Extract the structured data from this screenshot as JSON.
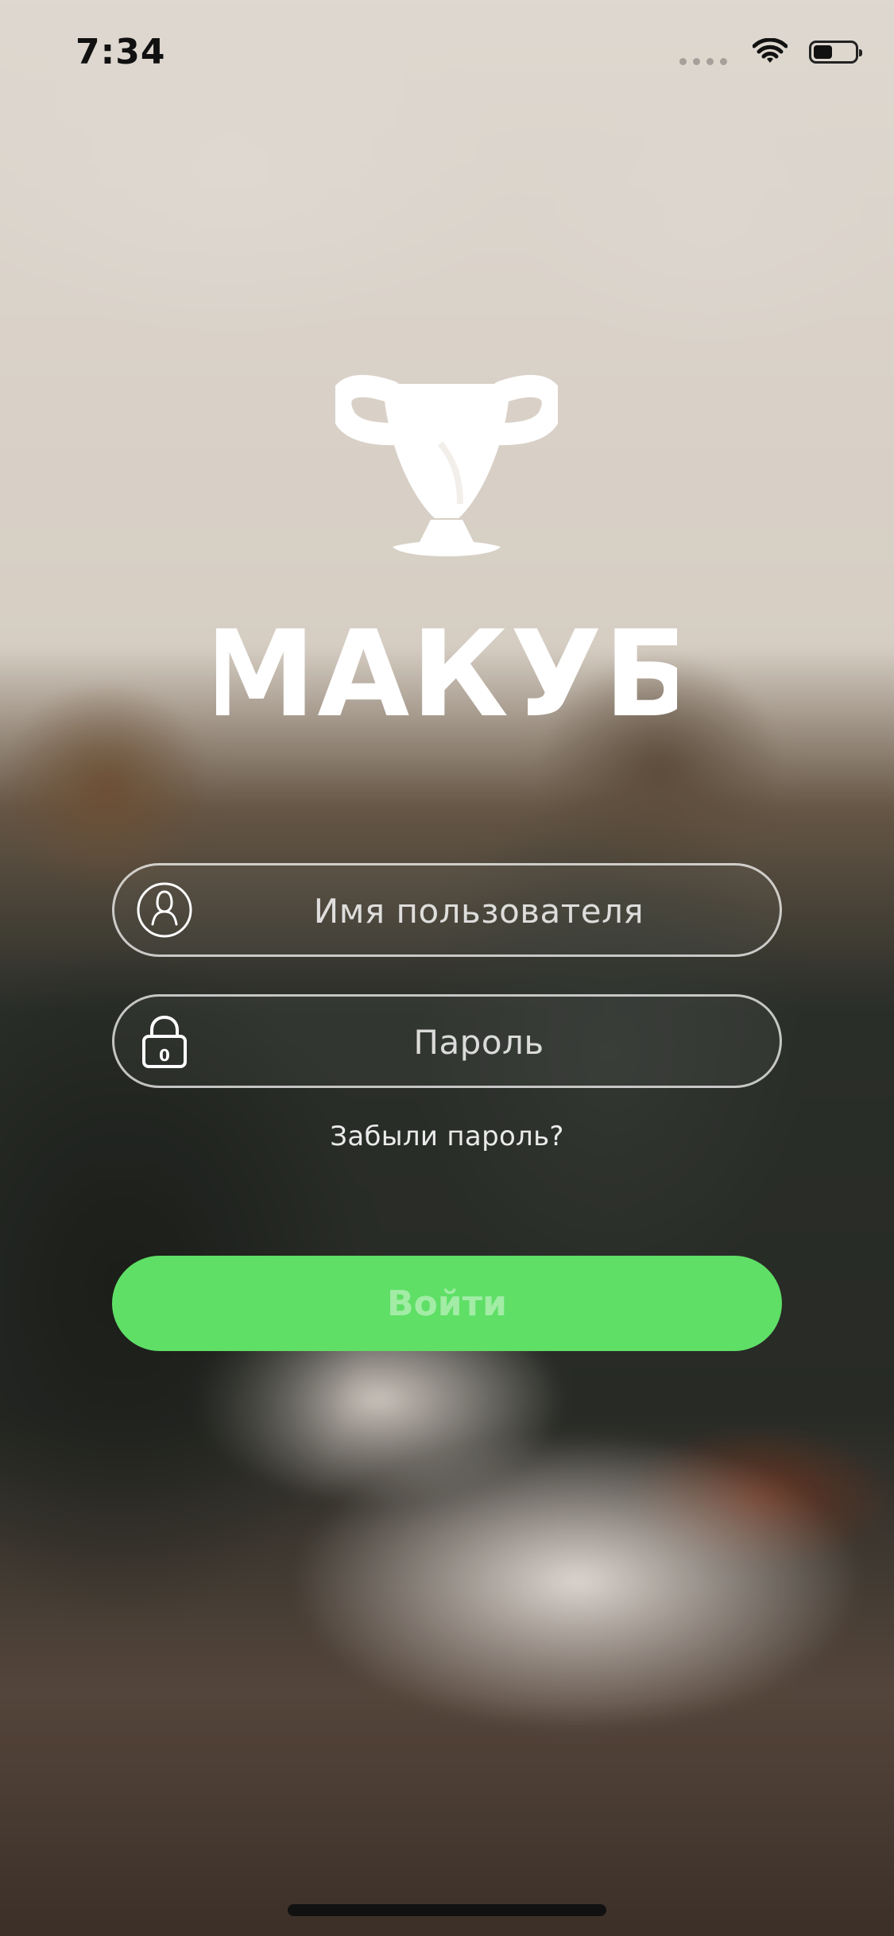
{
  "status_bar": {
    "time": "7:34"
  },
  "brand": {
    "name": "МАКУБ"
  },
  "login_form": {
    "username_placeholder": "Имя пользователя",
    "password_placeholder": "Пароль",
    "password_icon_digit": "0",
    "forgot_password": "Забыли пароль?",
    "login_button": "Войти"
  },
  "colors": {
    "accent": "#5fdf66",
    "field_border": "#ffffff",
    "text_light": "#ffffff",
    "status_text": "#111111"
  },
  "icons": {
    "status_bar": [
      "signal-dots-icon",
      "wifi-icon",
      "battery-icon"
    ],
    "username": "user-icon",
    "password": "lock-icon",
    "logo": "trophy-cup-icon"
  }
}
